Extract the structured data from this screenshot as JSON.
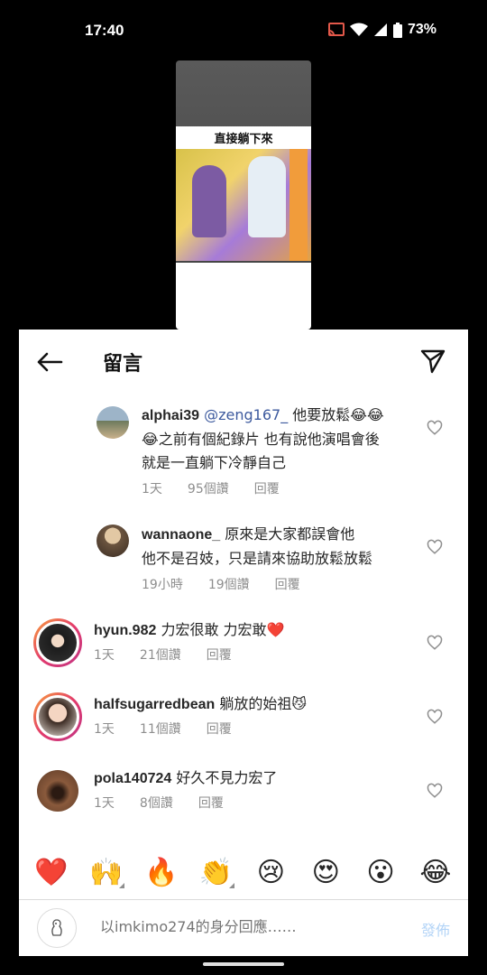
{
  "status": {
    "time": "17:40",
    "battery": "73%"
  },
  "video": {
    "caption": "直接躺下來"
  },
  "header": {
    "title": "留言"
  },
  "comments": [
    {
      "user": "alphai39",
      "mention": "@zeng167_",
      "text_line1": " 他要放鬆😂😂",
      "text_line2": "😂之前有個紀錄片 也有說他演唱會後",
      "text_line3": "就是一直躺下冷靜自己",
      "time": "1天",
      "likes": "95個讚",
      "reply": "回覆"
    },
    {
      "user": "wannaone_",
      "text_line1": " 原來是大家都誤會他",
      "text_line2": "他不是召妓，只是請來協助放鬆放鬆",
      "time": "19小時",
      "likes": "19個讚",
      "reply": "回覆"
    },
    {
      "user": "hyun.982",
      "text_line1": " 力宏很敢 力宏敢❤️",
      "time": "1天",
      "likes": "21個讚",
      "reply": "回覆"
    },
    {
      "user": "halfsugarredbean",
      "text_line1": " 躺放的始祖😼",
      "time": "1天",
      "likes": "11個讚",
      "reply": "回覆"
    },
    {
      "user": "pola140724",
      "text_line1": " 好久不見力宏了",
      "time": "1天",
      "likes": "8個讚",
      "reply": "回覆"
    }
  ],
  "emojis": [
    "❤️",
    "🙌",
    "🔥",
    "👏",
    "😢",
    "😍",
    "😮",
    "😂"
  ],
  "input": {
    "placeholder": "以imkimo274的身分回應……",
    "post_label": "發佈"
  }
}
